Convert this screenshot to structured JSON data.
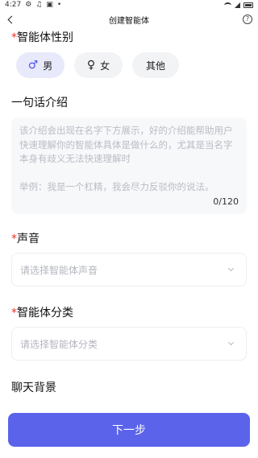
{
  "status_bar": {
    "time": "4:27",
    "icons": [
      "gear-icon",
      "music-icon",
      "image-icon",
      "dot-icon"
    ],
    "right_icons": [
      "wifi-icon",
      "signal-icon",
      "battery-icon"
    ]
  },
  "header": {
    "title": "创建智能体",
    "help_label": "?"
  },
  "gender": {
    "required_mark": "*",
    "label": "智能体性别",
    "options": [
      {
        "symbol": "♂",
        "label": "男",
        "selected": true
      },
      {
        "symbol": "♀",
        "label": "女",
        "selected": false
      },
      {
        "symbol": "",
        "label": "其他",
        "selected": false
      }
    ]
  },
  "intro": {
    "label": "一句话介绍",
    "placeholder": "该介绍会出现在名字下方展示，好的介绍能帮助用户快速理解你的智能体具体是做什么的，尤其是当名字本身有歧义无法快速理解时",
    "example": "举例：我是一个杠精，我会尽力反驳你的说法。",
    "counter": "0/120"
  },
  "voice": {
    "required_mark": "*",
    "label": "声音",
    "placeholder": "请选择智能体声音"
  },
  "category": {
    "required_mark": "*",
    "label": "智能体分类",
    "placeholder": "请选择智能体分类"
  },
  "background": {
    "label": "聊天背景"
  },
  "footer": {
    "next_label": "下一步"
  },
  "colors": {
    "accent": "#5a63ea",
    "required": "#e0372b"
  }
}
